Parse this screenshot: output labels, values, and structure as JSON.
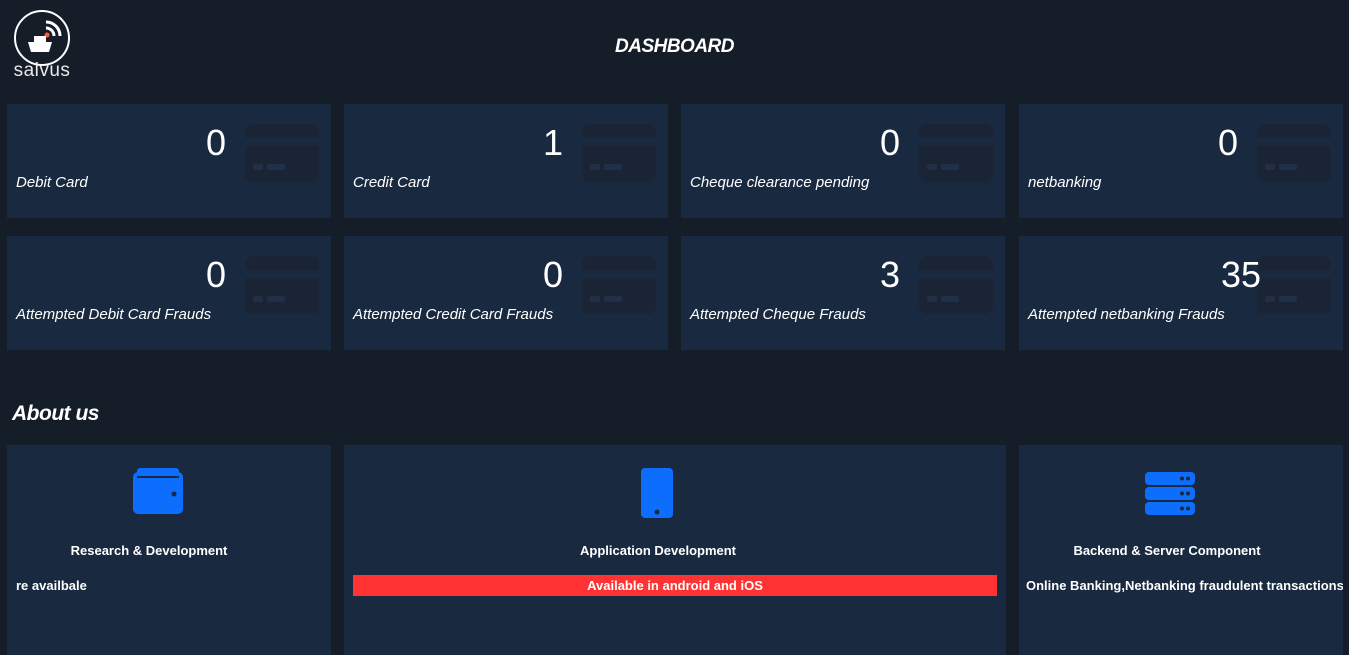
{
  "brand": {
    "name": "salvus"
  },
  "header": {
    "title": "DASHBOARD"
  },
  "stats": [
    {
      "value": "0",
      "label": "Debit Card"
    },
    {
      "value": "1",
      "label": "Credit Card"
    },
    {
      "value": "0",
      "label": "Cheque clearance pending"
    },
    {
      "value": "0",
      "label": "netbanking"
    },
    {
      "value": "0",
      "label": "Attempted Debit Card Frauds"
    },
    {
      "value": "0",
      "label": "Attempted Credit Card Frauds"
    },
    {
      "value": "3",
      "label": "Attempted Cheque Frauds"
    },
    {
      "value": "35",
      "label": "Attempted netbanking Frauds"
    }
  ],
  "about": {
    "title": "About us",
    "cards": [
      {
        "icon": "wallet-icon",
        "heading": "Research & Development",
        "text": "re availbale"
      },
      {
        "icon": "mobile-phone-icon",
        "heading": "Application Development",
        "text": "Available in android and iOS"
      },
      {
        "icon": "server-icon",
        "heading": "Backend & Server Component",
        "text": "Online Banking,Netbanking fraudulent transactions"
      }
    ]
  },
  "colors": {
    "background": "#151d29",
    "card": "#182940",
    "accent": "#0d6efd",
    "alert": "#ff3333"
  }
}
